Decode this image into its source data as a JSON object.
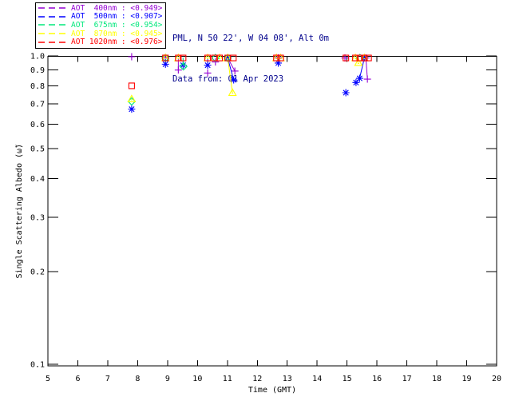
{
  "header": {
    "site_line": "PML, N 50 22', W 04 08', Alt 0m",
    "date_line": "Data from: 01 Apr 2023",
    "text_color": "#00008B"
  },
  "legend": {
    "items": [
      {
        "series": "400nm",
        "label": "AOT  400nm : <0.949>",
        "mean": "0.949",
        "color": "#9400D3"
      },
      {
        "series": "500nm",
        "label": "AOT  500nm : <0.907>",
        "mean": "0.907",
        "color": "#0000FF"
      },
      {
        "series": "675nm",
        "label": "AOT  675nm : <0.954>",
        "mean": "0.954",
        "color": "#00E87C"
      },
      {
        "series": "870nm",
        "label": "AOT  870nm : <0.945>",
        "mean": "0.945",
        "color": "#FFFF00"
      },
      {
        "series": "1020nm",
        "label": "AOT 1020nm : <0.976>",
        "mean": "0.976",
        "color": "#FF0000"
      }
    ]
  },
  "chart_data": {
    "type": "scatter",
    "title": "",
    "xlabel": "Time (GMT)",
    "ylabel": "Single Scattering Albedo (ω̃)",
    "xlim": [
      5,
      20
    ],
    "ylim": [
      0.1,
      1.0
    ],
    "y_scale": "log",
    "grid": false,
    "legend_position": "top-left",
    "x_ticks": [
      5,
      6,
      7,
      8,
      9,
      10,
      11,
      12,
      13,
      14,
      15,
      16,
      17,
      18,
      19,
      20
    ],
    "y_ticks": [
      1.0,
      0.9,
      0.8,
      0.7,
      0.6,
      0.5,
      0.4,
      0.3,
      0.2,
      0.1
    ],
    "series": [
      {
        "name": "AOT 400nm",
        "color": "#9400D3",
        "marker": "plus",
        "points": [
          [
            7.8,
            0.994
          ],
          [
            8.93,
            0.985
          ],
          [
            9.36,
            0.9
          ],
          [
            10.34,
            0.88
          ],
          [
            10.6,
            0.956
          ],
          [
            11.01,
            0.985
          ],
          [
            11.25,
            0.893
          ],
          [
            12.7,
            0.985
          ],
          [
            14.93,
            0.985
          ],
          [
            15.63,
            0.985
          ],
          [
            15.68,
            0.841
          ]
        ],
        "connectors": [
          [
            [
              9.36,
              0.985
            ],
            [
              9.36,
              0.9
            ]
          ],
          [
            [
              11.01,
              0.985
            ],
            [
              11.25,
              0.893
            ]
          ],
          [
            [
              15.63,
              0.985
            ],
            [
              15.68,
              0.841
            ]
          ]
        ]
      },
      {
        "name": "AOT 500nm",
        "color": "#0000FF",
        "marker": "asterisk",
        "points": [
          [
            7.8,
            0.672
          ],
          [
            8.93,
            0.94
          ],
          [
            9.52,
            0.933
          ],
          [
            10.34,
            0.933
          ],
          [
            11.01,
            0.985
          ],
          [
            11.21,
            0.836
          ],
          [
            12.7,
            0.948
          ],
          [
            14.96,
            0.76
          ],
          [
            15.3,
            0.82
          ],
          [
            15.42,
            0.846
          ],
          [
            15.58,
            0.985
          ]
        ],
        "connectors": [
          [
            [
              8.93,
              0.985
            ],
            [
              8.93,
              0.94
            ]
          ],
          [
            [
              9.52,
              0.985
            ],
            [
              9.52,
              0.933
            ]
          ],
          [
            [
              10.34,
              0.985
            ],
            [
              10.34,
              0.933
            ]
          ],
          [
            [
              11.01,
              0.985
            ],
            [
              11.21,
              0.836
            ]
          ],
          [
            [
              12.7,
              0.985
            ],
            [
              12.7,
              0.948
            ]
          ],
          [
            [
              15.58,
              0.985
            ],
            [
              15.42,
              0.846
            ]
          ]
        ]
      },
      {
        "name": "AOT 675nm",
        "color": "#00E87C",
        "marker": "diamond",
        "points": [
          [
            7.8,
            0.712
          ],
          [
            8.93,
            0.985
          ],
          [
            9.53,
            0.925
          ],
          [
            10.6,
            0.985
          ],
          [
            11.01,
            0.985
          ],
          [
            15.43,
            0.985
          ]
        ],
        "connectors": [
          [
            [
              9.52,
              0.985
            ],
            [
              9.53,
              0.925
            ]
          ]
        ]
      },
      {
        "name": "AOT 870nm",
        "color": "#FFFF00",
        "marker": "triangle",
        "points": [
          [
            7.8,
            0.725
          ],
          [
            8.93,
            0.985
          ],
          [
            9.36,
            0.985
          ],
          [
            10.34,
            0.985
          ],
          [
            10.74,
            0.985
          ],
          [
            11.01,
            0.985
          ],
          [
            11.17,
            0.76
          ],
          [
            12.64,
            0.985
          ],
          [
            12.78,
            0.985
          ],
          [
            15.28,
            0.985
          ],
          [
            15.38,
            0.951
          ],
          [
            15.58,
            0.985
          ]
        ],
        "connectors": [
          [
            [
              11.01,
              0.985
            ],
            [
              11.17,
              0.76
            ]
          ],
          [
            [
              15.28,
              0.985
            ],
            [
              15.38,
              0.951
            ]
          ]
        ]
      },
      {
        "name": "AOT 1020nm",
        "color": "#FF0000",
        "marker": "square",
        "points": [
          [
            7.8,
            0.8
          ],
          [
            8.93,
            0.985
          ],
          [
            9.36,
            0.985
          ],
          [
            9.52,
            0.985
          ],
          [
            10.34,
            0.985
          ],
          [
            10.57,
            0.985
          ],
          [
            10.74,
            0.985
          ],
          [
            11.01,
            0.985
          ],
          [
            11.2,
            0.985
          ],
          [
            12.64,
            0.985
          ],
          [
            12.78,
            0.985
          ],
          [
            14.96,
            0.985
          ],
          [
            15.28,
            0.985
          ],
          [
            15.43,
            0.985
          ],
          [
            15.58,
            0.985
          ],
          [
            15.72,
            0.985
          ]
        ],
        "connectors": []
      }
    ]
  }
}
